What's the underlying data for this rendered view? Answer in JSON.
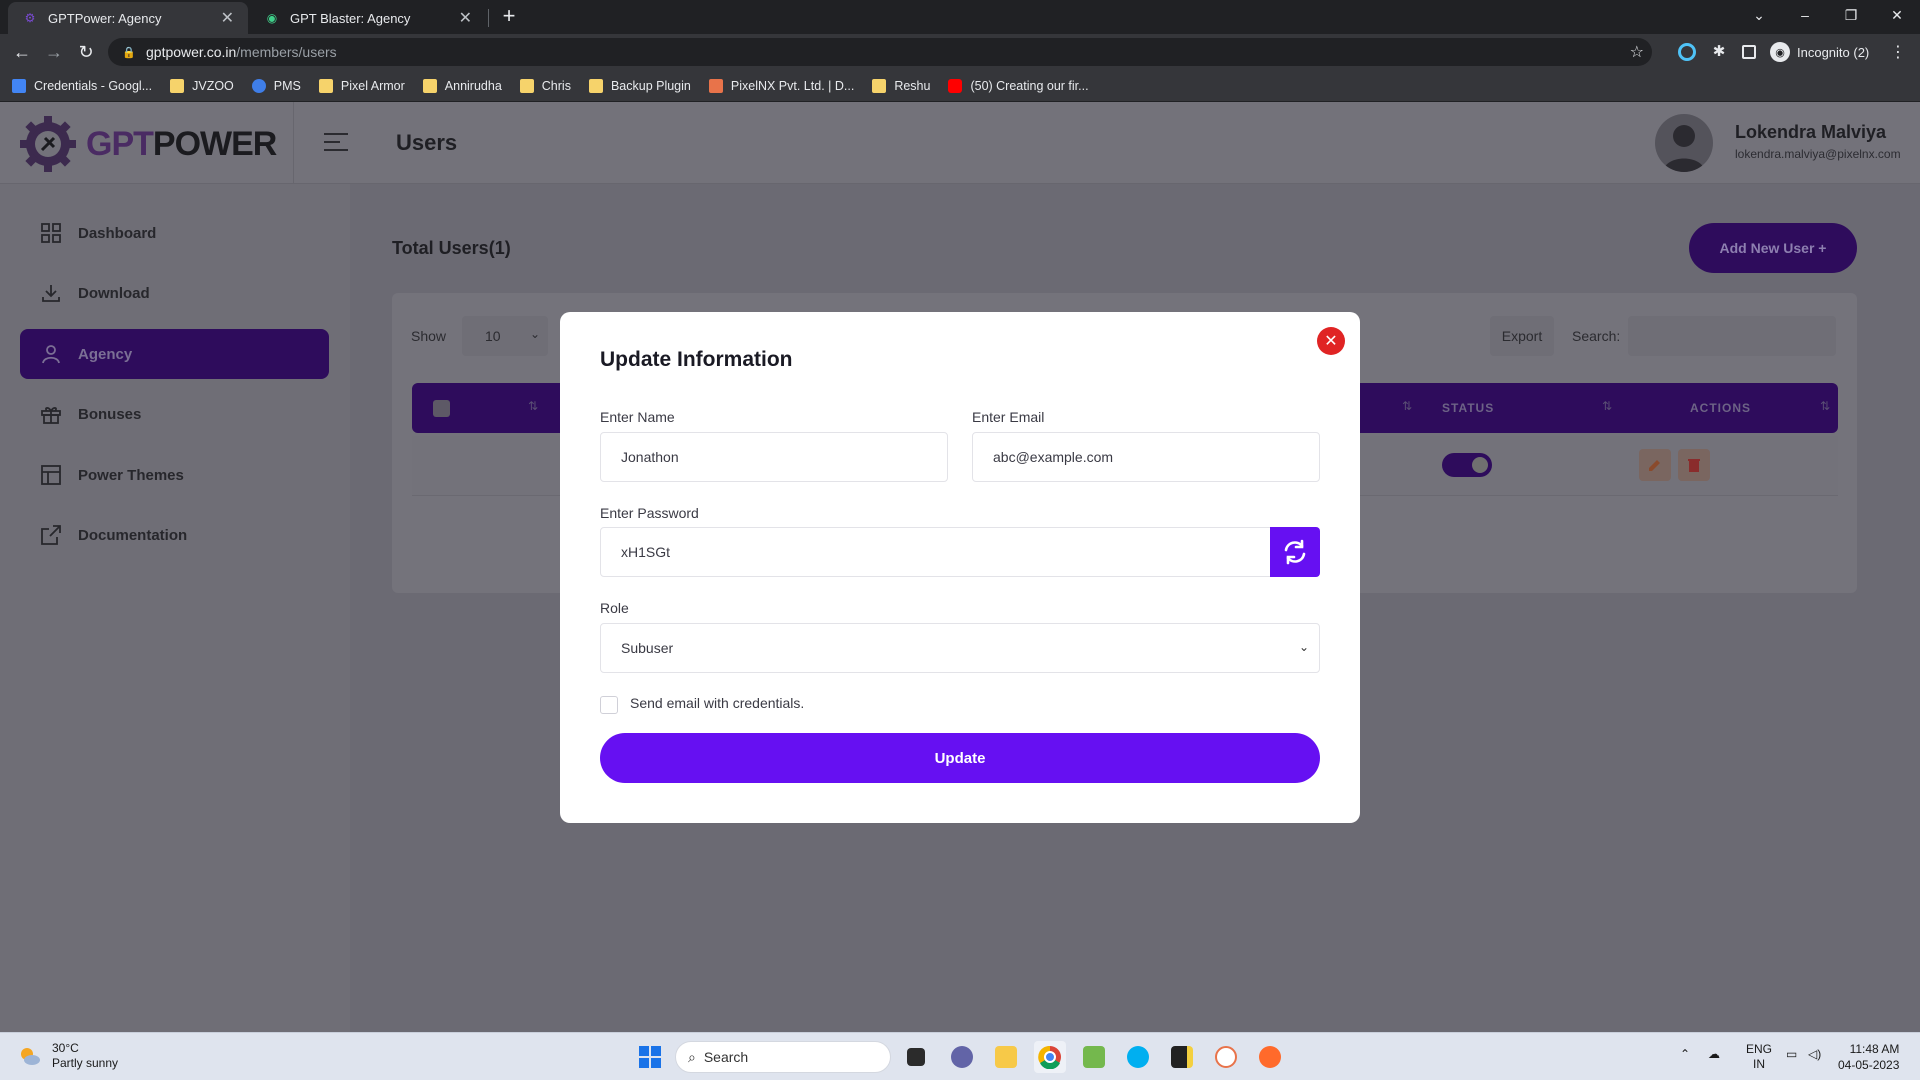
{
  "browser": {
    "tabs": [
      {
        "title": "GPTPower: Agency",
        "active": true
      },
      {
        "title": "GPT Blaster: Agency",
        "active": false
      }
    ],
    "url_host": "gptpower.co.in",
    "url_path": "/members/users",
    "profile_label": "Incognito (2)",
    "bookmarks": [
      {
        "label": "Credentials - Googl...",
        "icon": "google-docs-icon",
        "color": "#4285f4"
      },
      {
        "label": "JVZOO",
        "icon": "folder-icon",
        "color": "#f6d36b"
      },
      {
        "label": "PMS",
        "icon": "p-logo-icon",
        "color": "#3f7ee8"
      },
      {
        "label": "Pixel Armor",
        "icon": "folder-icon",
        "color": "#f6d36b"
      },
      {
        "label": "Annirudha",
        "icon": "folder-icon",
        "color": "#f6d36b"
      },
      {
        "label": "Chris",
        "icon": "folder-icon",
        "color": "#f6d36b"
      },
      {
        "label": "Backup Plugin",
        "icon": "folder-icon",
        "color": "#f6d36b"
      },
      {
        "label": "PixelNX Pvt. Ltd. | D...",
        "icon": "pixelnx-icon",
        "color": "#e8734a"
      },
      {
        "label": "Reshu",
        "icon": "folder-icon",
        "color": "#f6d36b"
      },
      {
        "label": "(50) Creating our fir...",
        "icon": "youtube-icon",
        "color": "#ff0000"
      }
    ]
  },
  "header": {
    "logo_gpt": "GPT",
    "logo_power": "POWER",
    "page_title": "Users",
    "user_name": "Lokendra Malviya",
    "user_email": "lokendra.malviya@pixelnx.com"
  },
  "sidebar": {
    "items": [
      {
        "label": "Dashboard",
        "icon": "grid-icon",
        "active": false
      },
      {
        "label": "Download",
        "icon": "download-icon",
        "active": false
      },
      {
        "label": "Agency",
        "icon": "user-icon",
        "active": true
      },
      {
        "label": "Bonuses",
        "icon": "gift-icon",
        "active": false
      },
      {
        "label": "Power Themes",
        "icon": "layout-icon",
        "active": false
      },
      {
        "label": "Documentation",
        "icon": "external-link-icon",
        "active": false
      }
    ]
  },
  "content": {
    "total_users": "Total Users(1)",
    "add_user_label": "Add New User +",
    "show_label": "Show",
    "show_value": "10",
    "export_label": "Export",
    "search_label": "Search:",
    "columns": [
      "STATUS",
      "ACTIONS"
    ]
  },
  "modal": {
    "title": "Update Information",
    "name_label": "Enter Name",
    "name_value": "Jonathon",
    "email_label": "Enter Email",
    "email_value": "abc@example.com",
    "password_label": "Enter Password",
    "password_value": "xH1SGt",
    "role_label": "Role",
    "role_value": "Subuser",
    "send_email_label": "Send email with credentials.",
    "submit_label": "Update"
  },
  "taskbar": {
    "temperature": "30°C",
    "weather": "Partly sunny",
    "search_label": "Search",
    "lang": "ENG",
    "region": "IN",
    "time": "11:48 AM",
    "date": "04-05-2023"
  },
  "colors": {
    "accent": "#6610f2",
    "close": "#e02424",
    "sidebar_active": "#2e0c5c"
  }
}
